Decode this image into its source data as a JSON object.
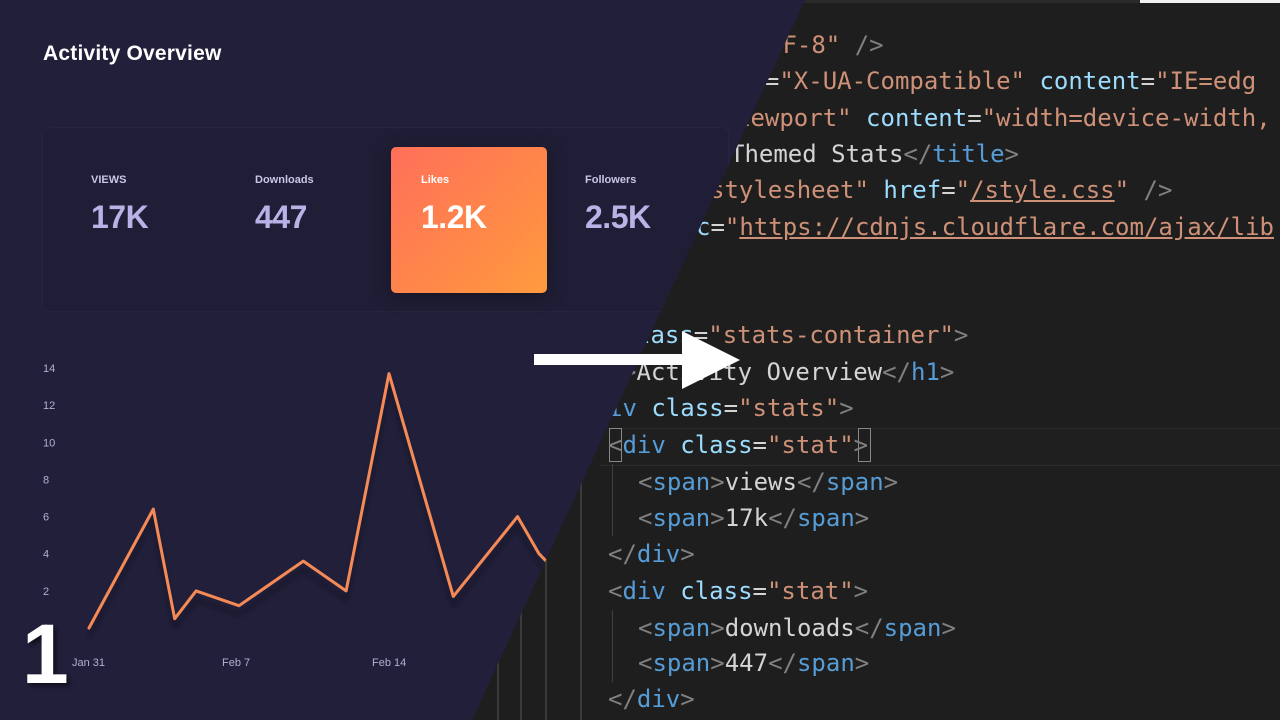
{
  "editor": {
    "lines": [
      {
        "top": 27,
        "left": 768,
        "tokens": [
          {
            "c": "tok-str",
            "t": "TF-8\""
          },
          {
            "c": "tok-text",
            "t": " "
          },
          {
            "c": "tok-punct",
            "t": "/>"
          }
        ]
      },
      {
        "top": 63,
        "left": 736,
        "tokens": [
          {
            "c": "tok-attr",
            "t": "iv"
          },
          {
            "c": "tok-text",
            "t": "="
          },
          {
            "c": "tok-str",
            "t": "\"X-UA-Compatible\""
          },
          {
            "c": "tok-text",
            "t": " "
          },
          {
            "c": "tok-attr",
            "t": "content"
          },
          {
            "c": "tok-text",
            "t": "="
          },
          {
            "c": "tok-str",
            "t": "\"IE=edg"
          }
        ]
      },
      {
        "top": 100,
        "left": 736,
        "tokens": [
          {
            "c": "tok-str",
            "t": "iewport\""
          },
          {
            "c": "tok-text",
            "t": " "
          },
          {
            "c": "tok-attr",
            "t": "content"
          },
          {
            "c": "tok-text",
            "t": "="
          },
          {
            "c": "tok-str",
            "t": "\"width=device-width,"
          }
        ]
      },
      {
        "top": 136,
        "left": 730,
        "tokens": [
          {
            "c": "tok-text",
            "t": "Themed Stats"
          },
          {
            "c": "tok-punct",
            "t": "</"
          },
          {
            "c": "tok-tag",
            "t": "title"
          },
          {
            "c": "tok-punct",
            "t": ">"
          }
        ]
      },
      {
        "top": 172,
        "left": 710,
        "tokens": [
          {
            "c": "tok-str",
            "t": "stylesheet\""
          },
          {
            "c": "tok-text",
            "t": " "
          },
          {
            "c": "tok-attr",
            "t": "href"
          },
          {
            "c": "tok-text",
            "t": "="
          },
          {
            "c": "tok-str",
            "t": "\""
          },
          {
            "c": "tok-url",
            "t": "/style.css"
          },
          {
            "c": "tok-str",
            "t": "\""
          },
          {
            "c": "tok-text",
            "t": " "
          },
          {
            "c": "tok-punct",
            "t": "/>"
          }
        ]
      },
      {
        "top": 209,
        "left": 696,
        "tokens": [
          {
            "c": "tok-attr",
            "t": "c"
          },
          {
            "c": "tok-text",
            "t": "="
          },
          {
            "c": "tok-str",
            "t": "\""
          },
          {
            "c": "tok-url",
            "t": "https://cdnjs.cloudflare.com/ajax/lib"
          }
        ]
      },
      {
        "top": 317,
        "left": 636,
        "tokens": [
          {
            "c": "tok-attr",
            "t": "lass"
          },
          {
            "c": "tok-text",
            "t": "="
          },
          {
            "c": "tok-str",
            "t": "\"stats-container\""
          },
          {
            "c": "tok-punct",
            "t": ">"
          }
        ]
      },
      {
        "top": 354,
        "left": 622,
        "tokens": [
          {
            "c": "tok-punct",
            "t": ">"
          },
          {
            "c": "tok-text",
            "t": "Activity Overview"
          },
          {
            "c": "tok-punct",
            "t": "</"
          },
          {
            "c": "tok-tag",
            "t": "h1"
          },
          {
            "c": "tok-punct",
            "t": ">"
          }
        ]
      },
      {
        "top": 390,
        "left": 608,
        "tokens": [
          {
            "c": "tok-tag",
            "t": "iv"
          },
          {
            "c": "tok-text",
            "t": " "
          },
          {
            "c": "tok-attr",
            "t": "class"
          },
          {
            "c": "tok-text",
            "t": "="
          },
          {
            "c": "tok-str",
            "t": "\"stats\""
          },
          {
            "c": "tok-punct",
            "t": ">"
          }
        ]
      },
      {
        "top": 427,
        "left": 608,
        "tokens": [
          {
            "c": "tok-punct",
            "t": "<"
          },
          {
            "c": "tok-tag",
            "t": "div"
          },
          {
            "c": "tok-text",
            "t": " "
          },
          {
            "c": "tok-attr",
            "t": "class"
          },
          {
            "c": "tok-text",
            "t": "="
          },
          {
            "c": "tok-str",
            "t": "\"stat\""
          },
          {
            "c": "tok-punct",
            "t": ">"
          }
        ]
      },
      {
        "top": 464,
        "left": 638,
        "tokens": [
          {
            "c": "tok-punct",
            "t": "<"
          },
          {
            "c": "tok-tag",
            "t": "span"
          },
          {
            "c": "tok-punct",
            "t": ">"
          },
          {
            "c": "tok-text",
            "t": "views"
          },
          {
            "c": "tok-punct",
            "t": "</"
          },
          {
            "c": "tok-tag",
            "t": "span"
          },
          {
            "c": "tok-punct",
            "t": ">"
          }
        ]
      },
      {
        "top": 500,
        "left": 638,
        "tokens": [
          {
            "c": "tok-punct",
            "t": "<"
          },
          {
            "c": "tok-tag",
            "t": "span"
          },
          {
            "c": "tok-punct",
            "t": ">"
          },
          {
            "c": "tok-text",
            "t": "17k"
          },
          {
            "c": "tok-punct",
            "t": "</"
          },
          {
            "c": "tok-tag",
            "t": "span"
          },
          {
            "c": "tok-punct",
            "t": ">"
          }
        ]
      },
      {
        "top": 536,
        "left": 608,
        "tokens": [
          {
            "c": "tok-punct",
            "t": "</"
          },
          {
            "c": "tok-tag",
            "t": "div"
          },
          {
            "c": "tok-punct",
            "t": ">"
          }
        ]
      },
      {
        "top": 573,
        "left": 608,
        "tokens": [
          {
            "c": "tok-punct",
            "t": "<"
          },
          {
            "c": "tok-tag",
            "t": "div"
          },
          {
            "c": "tok-text",
            "t": " "
          },
          {
            "c": "tok-attr",
            "t": "class"
          },
          {
            "c": "tok-text",
            "t": "="
          },
          {
            "c": "tok-str",
            "t": "\"stat\""
          },
          {
            "c": "tok-punct",
            "t": ">"
          }
        ]
      },
      {
        "top": 610,
        "left": 638,
        "tokens": [
          {
            "c": "tok-punct",
            "t": "<"
          },
          {
            "c": "tok-tag",
            "t": "span"
          },
          {
            "c": "tok-punct",
            "t": ">"
          },
          {
            "c": "tok-text",
            "t": "downloads"
          },
          {
            "c": "tok-punct",
            "t": "</"
          },
          {
            "c": "tok-tag",
            "t": "span"
          },
          {
            "c": "tok-punct",
            "t": ">"
          }
        ]
      },
      {
        "top": 645,
        "left": 638,
        "tokens": [
          {
            "c": "tok-punct",
            "t": "<"
          },
          {
            "c": "tok-tag",
            "t": "span"
          },
          {
            "c": "tok-punct",
            "t": ">"
          },
          {
            "c": "tok-text",
            "t": "447"
          },
          {
            "c": "tok-punct",
            "t": "</"
          },
          {
            "c": "tok-tag",
            "t": "span"
          },
          {
            "c": "tok-punct",
            "t": ">"
          }
        ]
      },
      {
        "top": 681,
        "left": 608,
        "tokens": [
          {
            "c": "tok-punct",
            "t": "</"
          },
          {
            "c": "tok-tag",
            "t": "div"
          },
          {
            "c": "tok-punct",
            "t": ">"
          }
        ]
      }
    ]
  },
  "dashboard": {
    "title": "Activity Overview",
    "stats": [
      {
        "label": "VIEWS",
        "value": "17K",
        "active": false
      },
      {
        "label": "Downloads",
        "value": "447",
        "active": false
      },
      {
        "label": "Likes",
        "value": "1.2K",
        "active": true
      },
      {
        "label": "Followers",
        "value": "2.5K",
        "active": false
      }
    ]
  },
  "step_number": "1",
  "colors": {
    "accent_start": "#ff6f5a",
    "accent_end": "#ff9a3d",
    "line": "#f58a56",
    "dash_bg": "#211f3a",
    "editor_bg": "#1e1e1e"
  },
  "chart_data": {
    "type": "line",
    "y_ticks": [
      "0",
      "2",
      "4",
      "6",
      "8",
      "10",
      "12",
      "14"
    ],
    "x_ticks": [
      "Jan 31",
      "Feb 7",
      "Feb 14"
    ],
    "ylim": [
      0,
      14
    ],
    "series": [
      {
        "values": [
          {
            "x": "Jan 31",
            "y": 0
          },
          {
            "x": "Feb 3",
            "y": 6.4
          },
          {
            "x": "Feb 4",
            "y": 0.5
          },
          {
            "x": "Feb 5",
            "y": 2
          },
          {
            "x": "Feb 7",
            "y": 1.2
          },
          {
            "x": "Feb 10",
            "y": 3.6
          },
          {
            "x": "Feb 12",
            "y": 2
          },
          {
            "x": "Feb 14",
            "y": 13.7
          },
          {
            "x": "Feb 17",
            "y": 1.7
          },
          {
            "x": "Feb 20",
            "y": 6
          },
          {
            "x": "Feb 21",
            "y": 4
          },
          {
            "x": "Feb 22",
            "y": 2.8
          }
        ]
      }
    ]
  }
}
